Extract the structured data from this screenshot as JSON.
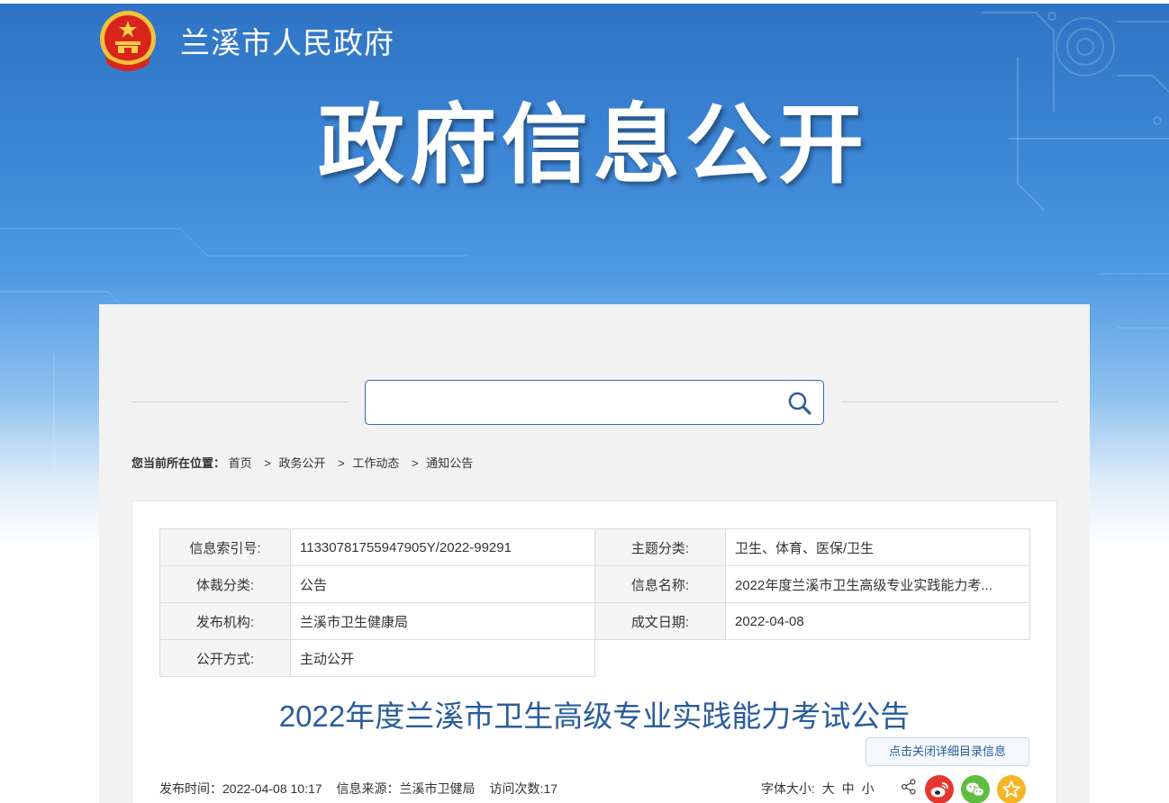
{
  "header": {
    "site_name": "兰溪市人民政府",
    "banner_title": "政府信息公开"
  },
  "search": {
    "value": "",
    "placeholder": ""
  },
  "breadcrumb": {
    "prefix": "您当前所在位置：",
    "items": [
      {
        "label": "首页"
      },
      {
        "label": "政务公开"
      },
      {
        "label": "工作动态"
      },
      {
        "label": "通知公告"
      }
    ],
    "separator": ">"
  },
  "meta_table": {
    "rows": [
      {
        "k1": "信息索引号:",
        "v1": "11330781755947905Y/2022-99291",
        "k2": "主题分类:",
        "v2": "卫生、体育、医保/卫生"
      },
      {
        "k1": "体裁分类:",
        "v1": "公告",
        "k2": "信息名称:",
        "v2": "2022年度兰溪市卫生高级专业实践能力考..."
      },
      {
        "k1": "发布机构:",
        "v1": "兰溪市卫生健康局",
        "k2": "成文日期:",
        "v2": "2022-04-08"
      },
      {
        "k1": "公开方式:",
        "v1": "主动公开"
      }
    ]
  },
  "article": {
    "title": "2022年度兰溪市卫生高级专业实践能力考试公告",
    "toggle_label": "点击关闭详细目录信息",
    "publish_time_label": "发布时间：",
    "publish_time": "2022-04-08 10:17",
    "source_label": "信息来源：",
    "source": "兰溪市卫健局",
    "visits_label": "访问次数:",
    "visits": "17"
  },
  "font_size": {
    "label": "字体大小:",
    "large": "大",
    "medium": "中",
    "small": "小"
  },
  "colors": {
    "banner_blue": "#3d87d6",
    "title_blue": "#2a5c9a",
    "weibo_red": "#e6372f",
    "wechat_green": "#5fbd3f",
    "favorite_yellow": "#f6b526"
  },
  "icons": {
    "emblem": "national-emblem-icon",
    "search": "search-icon",
    "share": "share-icon",
    "weibo": "weibo-icon",
    "wechat": "wechat-icon",
    "favorite": "star-icon"
  }
}
